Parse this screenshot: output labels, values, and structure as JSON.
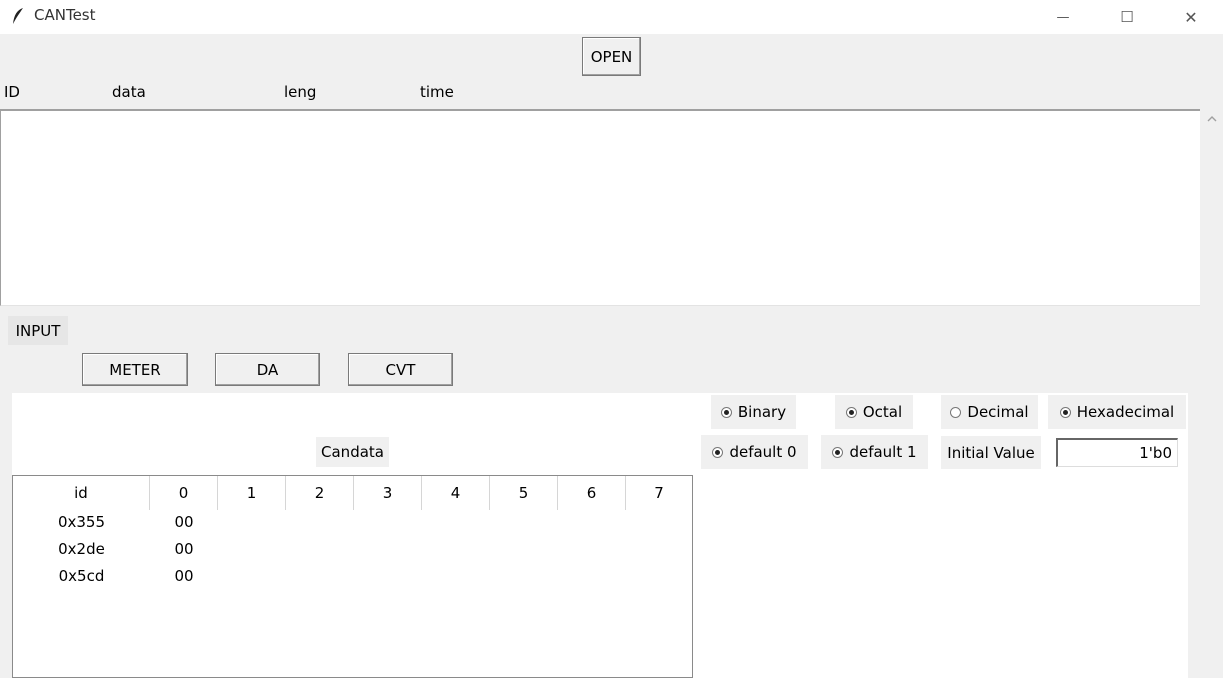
{
  "window": {
    "title": "CANTest",
    "controls": {
      "minimize": "—",
      "maximize": "☐",
      "close": "✕"
    }
  },
  "toolbar": {
    "open_label": "OPEN"
  },
  "rx_list": {
    "headers": {
      "id": "ID",
      "data": "data",
      "length": "leng",
      "time": "time"
    },
    "scroll_up": "^"
  },
  "input_section": {
    "label": "INPUT"
  },
  "mode_buttons": {
    "meter": "METER",
    "da": "DA",
    "cvt": "CVT"
  },
  "radix": {
    "binary": "Binary",
    "octal": "Octal",
    "decimal": "Decimal",
    "hexadecimal": "Hexadecimal"
  },
  "defaults": {
    "default0": "default 0",
    "default1": "default 1",
    "initial_value_label": "Initial Value",
    "initial_value": "1'b0"
  },
  "candata": {
    "title": "Candata",
    "columns": [
      "id",
      "0",
      "1",
      "2",
      "3",
      "4",
      "5",
      "6",
      "7"
    ],
    "rows": [
      {
        "id": "0x355",
        "b0": "00"
      },
      {
        "id": "0x2de",
        "b0": "00"
      },
      {
        "id": "0x5cd",
        "b0": "00"
      }
    ]
  }
}
